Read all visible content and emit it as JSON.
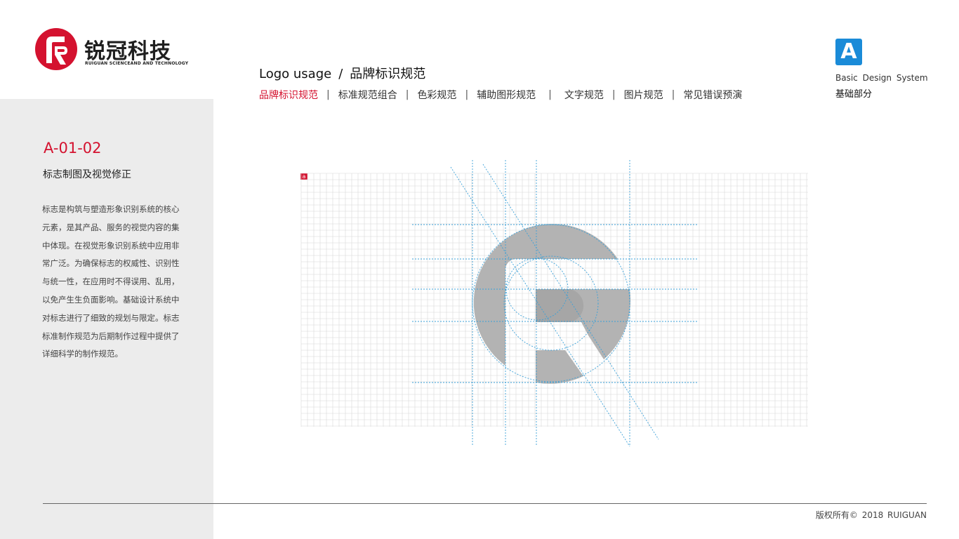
{
  "brand": {
    "name_cn": "锐冠科技",
    "name_en": "RUIGUAN SCIENCEAND AND TECHNOLOGY",
    "logo_letter": "R",
    "color": "#d4122f"
  },
  "header": {
    "title_en": "Logo usage",
    "separator": "/",
    "title_cn": "品牌标识规范"
  },
  "nav": {
    "items": [
      "品牌标识规范",
      "标准规范组合",
      "色彩规范",
      "辅助图形规范",
      "文字规范",
      "图片规范",
      "常见错误预演"
    ],
    "divider": "|",
    "active": "品牌标识规范"
  },
  "badge": {
    "letter": "A",
    "label_en": "Basic Design System",
    "label_cn": "基础部分",
    "color": "#1a8bd8"
  },
  "page": {
    "code": "A-01-02",
    "subtitle": "标志制图及视觉修正",
    "description": "标志是构筑与塑造形象识别系统的核心元素，是其产品、服务的视觉内容的集中体现。在视觉形象识别系统中应用非常广泛。为确保标志的权威性、识别性与统一性，在应用时不得误用、乱用，以免产生生负面影响。基础设计系统中对标志进行了细致的规划与限定。标志标准制作规范为后期制作过程中提供了详细科学的制作规范。"
  },
  "diagram": {
    "grid_label": "a",
    "grid_color": "#d8d8d8",
    "guide_color": "#3aa0d8",
    "logo_color": "#b3b3b3"
  },
  "footer": {
    "copyright": "版权所有© 2018 RUIGUAN"
  }
}
